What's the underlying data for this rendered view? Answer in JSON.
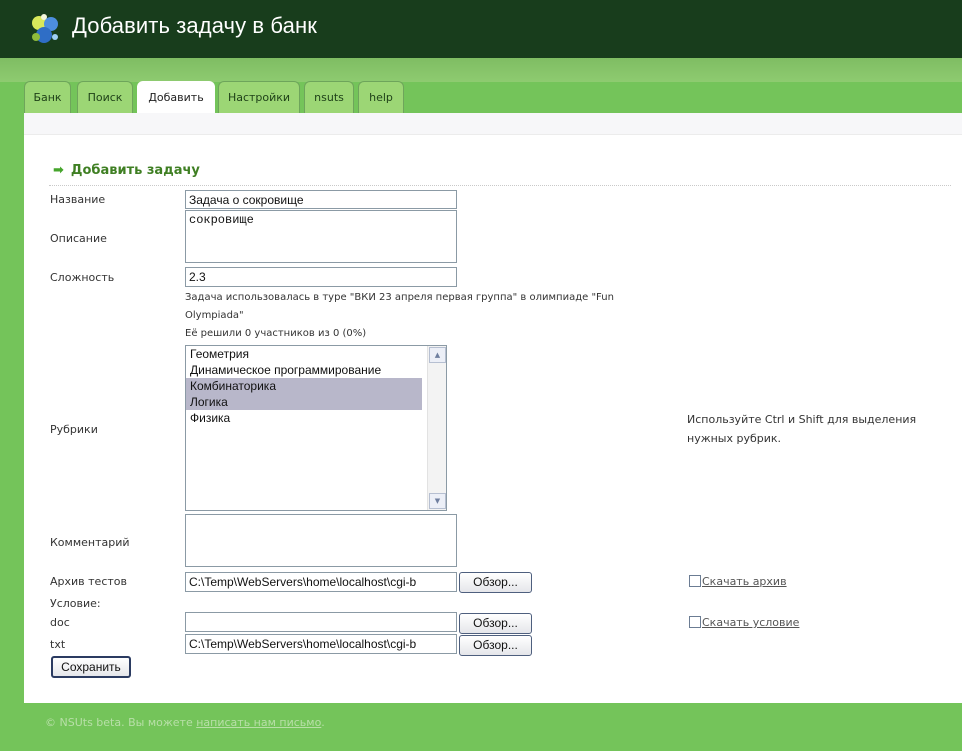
{
  "header": {
    "title": "Добавить задачу в банк",
    "logo_icon": "nsuts-logo-icon"
  },
  "tabs": [
    {
      "label": "Банк",
      "active": false
    },
    {
      "label": "Поиск",
      "active": false
    },
    {
      "label": "Добавить",
      "active": true
    },
    {
      "label": "Настройки",
      "active": false
    },
    {
      "label": "nsuts",
      "active": false
    },
    {
      "label": "help",
      "active": false
    }
  ],
  "form": {
    "section_title": "Добавить задачу",
    "name": {
      "label": "Название",
      "value": "Задача о сокровище"
    },
    "description": {
      "label": "Описание",
      "value": "сокровище"
    },
    "difficulty": {
      "label": "Сложность",
      "value": "2.3"
    },
    "usage_info": {
      "line1": "Задача использовалась в туре \"ВКИ 23 апреля первая группа\" в олимпиаде \"Fun",
      "line2": "Olympiada\"",
      "solved": "Её решили 0 участников из 0 (0%)"
    },
    "rubrics": {
      "label": "Рубрики",
      "options": [
        {
          "label": "Геометрия",
          "selected": false
        },
        {
          "label": "Динамическое программирование",
          "selected": false
        },
        {
          "label": "Комбинаторика",
          "selected": true
        },
        {
          "label": "Логика",
          "selected": true
        },
        {
          "label": "Физика",
          "selected": false
        }
      ],
      "hint": "Используйте Ctrl и Shift для выделения нужных рубрик."
    },
    "comment": {
      "label": "Комментарий",
      "value": ""
    },
    "test_archive": {
      "label": "Архив тестов",
      "value": "C:\\Temp\\WebServers\\home\\localhost\\cgi-b",
      "browse_label": "Обзор...",
      "download_label": "Скачать архив"
    },
    "condition": {
      "label": "Условие:"
    },
    "doc": {
      "label": "doc",
      "value": "",
      "browse_label": "Обзор...",
      "download_label": "Скачать условие"
    },
    "txt": {
      "label": "txt",
      "value": "C:\\Temp\\WebServers\\home\\localhost\\cgi-b",
      "browse_label": "Обзор..."
    },
    "save_label": "Сохранить"
  },
  "footer": {
    "copyright": "© NSUts beta",
    "text": ". Вы можете ",
    "link": "написать нам письмо",
    "end": "."
  },
  "colors": {
    "header_bg": "#183d1c",
    "page_bg": "#74c45a",
    "tab_bg": "#9cd675",
    "accent_green": "#3f7f23",
    "selected_option_bg": "#b8b7ca"
  }
}
